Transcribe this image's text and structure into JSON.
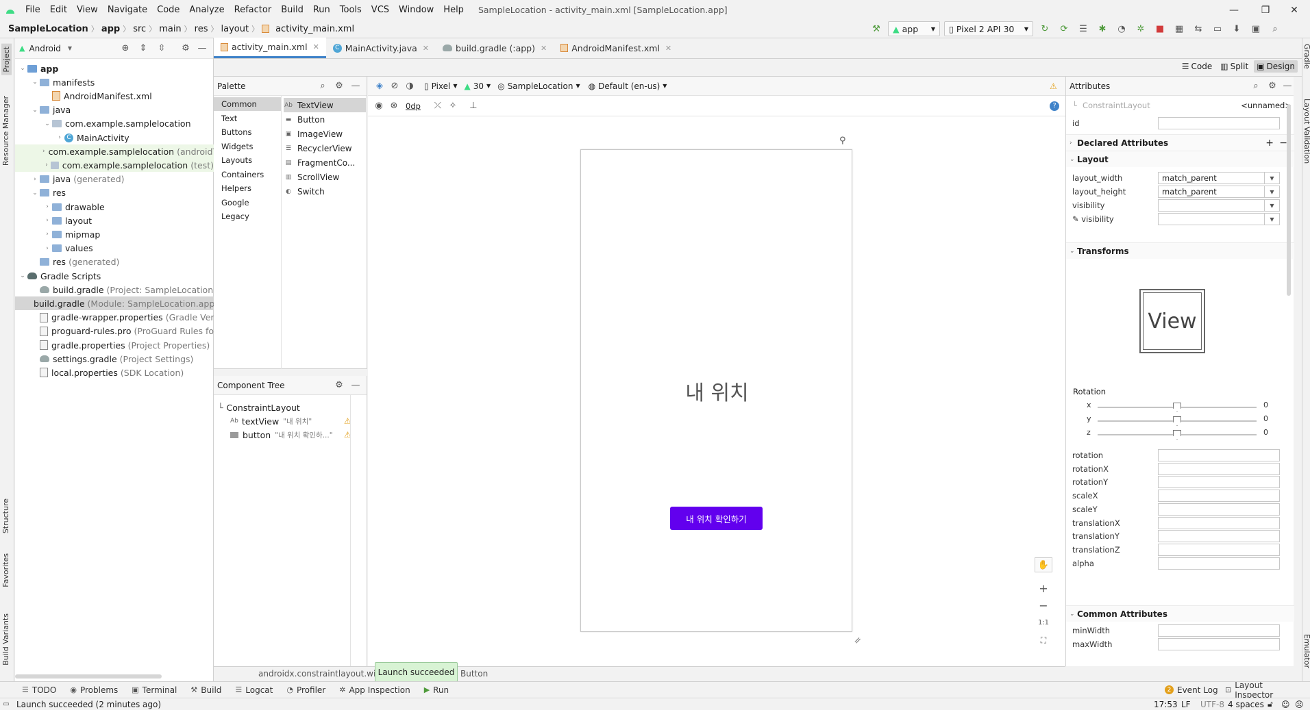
{
  "window": {
    "title": "SampleLocation - activity_main.xml [SampleLocation.app]",
    "menu": [
      "File",
      "Edit",
      "View",
      "Navigate",
      "Code",
      "Analyze",
      "Refactor",
      "Build",
      "Run",
      "Tools",
      "VCS",
      "Window",
      "Help"
    ]
  },
  "breadcrumb": [
    "SampleLocation",
    "app",
    "src",
    "main",
    "res",
    "layout",
    "activity_main.xml"
  ],
  "run_config": {
    "module": "app",
    "device": "Pixel 2 API 30"
  },
  "project_panel": {
    "view_mode": "Android",
    "tree": [
      {
        "label": "app",
        "suffix": "",
        "level": 0
      },
      {
        "label": "manifests",
        "suffix": "",
        "level": 1
      },
      {
        "label": "AndroidManifest.xml",
        "suffix": "",
        "level": 2
      },
      {
        "label": "java",
        "suffix": "",
        "level": 1
      },
      {
        "label": "com.example.samplelocation",
        "suffix": "",
        "level": 2
      },
      {
        "label": "MainActivity",
        "suffix": "",
        "level": 3
      },
      {
        "label": "com.example.samplelocation",
        "suffix": "(androidT",
        "level": 2
      },
      {
        "label": "com.example.samplelocation",
        "suffix": "(test)",
        "level": 2
      },
      {
        "label": "java",
        "suffix": "(generated)",
        "level": 1
      },
      {
        "label": "res",
        "suffix": "",
        "level": 1
      },
      {
        "label": "drawable",
        "suffix": "",
        "level": 2
      },
      {
        "label": "layout",
        "suffix": "",
        "level": 2
      },
      {
        "label": "mipmap",
        "suffix": "",
        "level": 2
      },
      {
        "label": "values",
        "suffix": "",
        "level": 2
      },
      {
        "label": "res",
        "suffix": "(generated)",
        "level": 1
      },
      {
        "label": "Gradle Scripts",
        "suffix": "",
        "level": 0
      },
      {
        "label": "build.gradle",
        "suffix": "(Project: SampleLocation)",
        "level": 1
      },
      {
        "label": "build.gradle",
        "suffix": "(Module: SampleLocation.app",
        "level": 1
      },
      {
        "label": "gradle-wrapper.properties",
        "suffix": "(Gradle Version)",
        "level": 1
      },
      {
        "label": "proguard-rules.pro",
        "suffix": "(ProGuard Rules for Sa",
        "level": 1
      },
      {
        "label": "gradle.properties",
        "suffix": "(Project Properties)",
        "level": 1
      },
      {
        "label": "settings.gradle",
        "suffix": "(Project Settings)",
        "level": 1
      },
      {
        "label": "local.properties",
        "suffix": "(SDK Location)",
        "level": 1
      }
    ]
  },
  "editor_tabs": [
    "activity_main.xml",
    "MainActivity.java",
    "build.gradle (:app)",
    "AndroidManifest.xml"
  ],
  "view_modes": [
    "Code",
    "Split",
    "Design"
  ],
  "palette": {
    "title": "Palette",
    "categories": [
      "Common",
      "Text",
      "Buttons",
      "Widgets",
      "Layouts",
      "Containers",
      "Helpers",
      "Google",
      "Legacy"
    ],
    "items": [
      "TextView",
      "Button",
      "ImageView",
      "RecyclerView",
      "FragmentCo...",
      "ScrollView",
      "Switch"
    ],
    "item_icons": [
      "Ab",
      "▬",
      "▣",
      "☰",
      "▤",
      "▥",
      "◐"
    ]
  },
  "component_tree": {
    "title": "Component Tree",
    "root": "ConstraintLayout",
    "children": [
      {
        "type": "textView",
        "text": "\"내 위치\""
      },
      {
        "type": "button",
        "text": "\"내 위치 확인하...\""
      }
    ]
  },
  "design_toolbar": {
    "device": "Pixel",
    "api": "30",
    "theme": "SampleLocation",
    "locale": "Default (en-us)",
    "margin": "0dp"
  },
  "phone": {
    "text": "내 위치",
    "button": "내 위치 확인하기"
  },
  "attributes": {
    "title": "Attributes",
    "component": "ConstraintLayout",
    "name": "<unnamed>",
    "id_label": "id",
    "declared": "Declared Attributes",
    "layout_section": "Layout",
    "layout_rows": [
      {
        "label": "layout_width",
        "value": "match_parent"
      },
      {
        "label": "layout_height",
        "value": "match_parent"
      },
      {
        "label": "visibility",
        "value": ""
      },
      {
        "label": "visibility",
        "value": ""
      }
    ],
    "transforms": "Transforms",
    "view_preview": "View",
    "rotation_label": "Rotation",
    "rotation_axes": [
      {
        "axis": "x",
        "value": "0"
      },
      {
        "axis": "y",
        "value": "0"
      },
      {
        "axis": "z",
        "value": "0"
      }
    ],
    "transform_rows": [
      "rotation",
      "rotationX",
      "rotationY",
      "scaleX",
      "scaleY",
      "translationX",
      "translationY",
      "translationZ",
      "alpha"
    ],
    "common_section": "Common Attributes",
    "common_rows": [
      "minWidth",
      "maxWidth"
    ]
  },
  "status_path": "androidx.constraintlayout.widge",
  "status_path2": "Button",
  "toast": "Launch succeeded",
  "bottom_tabs": [
    "TODO",
    "Problems",
    "Terminal",
    "Build",
    "Logcat",
    "Profiler",
    "App Inspection",
    "Run"
  ],
  "bottom_right": {
    "event_log": "Event Log",
    "event_count": "2",
    "layout_inspector": "Layout Inspector"
  },
  "statusbar": {
    "message": "Launch succeeded (2 minutes ago)",
    "time": "17:53",
    "line_sep": "LF",
    "encoding": "UTF-8",
    "indent": "4 spaces"
  },
  "side_tabs": {
    "left": [
      "Project",
      "Resource Manager",
      "Structure",
      "Favorites",
      "Build Variants"
    ],
    "right": [
      "Gradle",
      "Layout Validation",
      "Emulator"
    ]
  },
  "colors": {
    "accent": "#4083c9",
    "button": "#6200ee",
    "toast": "#d8f3d4"
  }
}
